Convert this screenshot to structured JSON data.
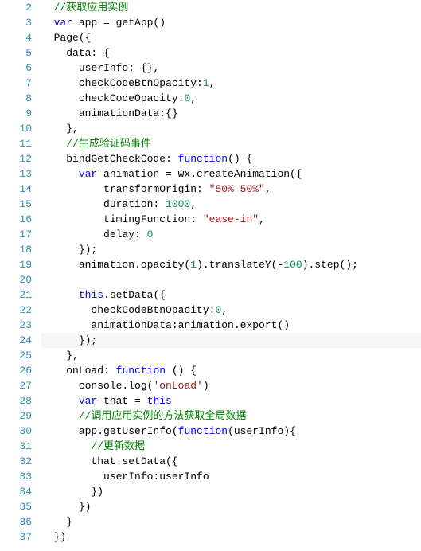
{
  "lines": [
    {
      "num": 2,
      "indent": 1,
      "tokens": [
        {
          "c": "c",
          "t": "//获取应用实例"
        }
      ]
    },
    {
      "num": 3,
      "indent": 1,
      "tokens": [
        {
          "c": "k",
          "t": "var"
        },
        {
          "c": "p",
          "t": " app = getApp()"
        }
      ]
    },
    {
      "num": 4,
      "indent": 1,
      "tokens": [
        {
          "c": "p",
          "t": "Page({"
        }
      ]
    },
    {
      "num": 5,
      "indent": 2,
      "tokens": [
        {
          "c": "p",
          "t": "data: {"
        }
      ]
    },
    {
      "num": 6,
      "indent": 3,
      "tokens": [
        {
          "c": "p",
          "t": "userInfo: {},"
        }
      ]
    },
    {
      "num": 7,
      "indent": 3,
      "tokens": [
        {
          "c": "p",
          "t": "checkCodeBtnOpacity:"
        },
        {
          "c": "n",
          "t": "1"
        },
        {
          "c": "p",
          "t": ","
        }
      ]
    },
    {
      "num": 8,
      "indent": 3,
      "tokens": [
        {
          "c": "p",
          "t": "checkCodeOpacity:"
        },
        {
          "c": "n",
          "t": "0"
        },
        {
          "c": "p",
          "t": ","
        }
      ]
    },
    {
      "num": 9,
      "indent": 3,
      "tokens": [
        {
          "c": "p",
          "t": "animationData:{}"
        }
      ]
    },
    {
      "num": 10,
      "indent": 2,
      "tokens": [
        {
          "c": "p",
          "t": "},"
        }
      ]
    },
    {
      "num": 11,
      "indent": 2,
      "tokens": [
        {
          "c": "c",
          "t": "//生成验证码事件"
        }
      ]
    },
    {
      "num": 12,
      "indent": 2,
      "tokens": [
        {
          "c": "p",
          "t": "bindGetCheckCode: "
        },
        {
          "c": "k",
          "t": "function"
        },
        {
          "c": "p",
          "t": "() {"
        }
      ]
    },
    {
      "num": 13,
      "indent": 3,
      "tokens": [
        {
          "c": "k",
          "t": "var"
        },
        {
          "c": "p",
          "t": " animation = wx.createAnimation({"
        }
      ]
    },
    {
      "num": 14,
      "indent": 5,
      "tokens": [
        {
          "c": "p",
          "t": "transformOrigin: "
        },
        {
          "c": "s",
          "t": "\"50% 50%\""
        },
        {
          "c": "p",
          "t": ","
        }
      ]
    },
    {
      "num": 15,
      "indent": 5,
      "tokens": [
        {
          "c": "p",
          "t": "duration: "
        },
        {
          "c": "n",
          "t": "1000"
        },
        {
          "c": "p",
          "t": ","
        }
      ]
    },
    {
      "num": 16,
      "indent": 5,
      "tokens": [
        {
          "c": "p",
          "t": "timingFunction: "
        },
        {
          "c": "s",
          "t": "\"ease-in\""
        },
        {
          "c": "p",
          "t": ","
        }
      ]
    },
    {
      "num": 17,
      "indent": 5,
      "tokens": [
        {
          "c": "p",
          "t": "delay: "
        },
        {
          "c": "n",
          "t": "0"
        }
      ]
    },
    {
      "num": 18,
      "indent": 3,
      "tokens": [
        {
          "c": "p",
          "t": "});"
        }
      ]
    },
    {
      "num": 19,
      "indent": 3,
      "tokens": [
        {
          "c": "p",
          "t": "animation.opacity("
        },
        {
          "c": "n",
          "t": "1"
        },
        {
          "c": "p",
          "t": ").translateY(-"
        },
        {
          "c": "n",
          "t": "100"
        },
        {
          "c": "p",
          "t": ").step();"
        }
      ]
    },
    {
      "num": 20,
      "indent": 0,
      "tokens": [
        {
          "c": "p",
          "t": ""
        }
      ]
    },
    {
      "num": 21,
      "indent": 3,
      "tokens": [
        {
          "c": "k",
          "t": "this"
        },
        {
          "c": "p",
          "t": ".setData({"
        }
      ]
    },
    {
      "num": 22,
      "indent": 4,
      "tokens": [
        {
          "c": "p",
          "t": "checkCodeBtnOpacity:"
        },
        {
          "c": "n",
          "t": "0"
        },
        {
          "c": "p",
          "t": ","
        }
      ]
    },
    {
      "num": 23,
      "indent": 4,
      "tokens": [
        {
          "c": "p",
          "t": "animationData:animation.export()"
        }
      ]
    },
    {
      "num": 24,
      "indent": 3,
      "hl": true,
      "tokens": [
        {
          "c": "p",
          "t": "});"
        }
      ]
    },
    {
      "num": 25,
      "indent": 2,
      "tokens": [
        {
          "c": "p",
          "t": "},"
        }
      ]
    },
    {
      "num": 26,
      "indent": 2,
      "tokens": [
        {
          "c": "p",
          "t": "onLoad: "
        },
        {
          "c": "k",
          "t": "function"
        },
        {
          "c": "p",
          "t": " () {"
        }
      ]
    },
    {
      "num": 27,
      "indent": 3,
      "tokens": [
        {
          "c": "p",
          "t": "console.log("
        },
        {
          "c": "s",
          "t": "'onLoad'"
        },
        {
          "c": "p",
          "t": ")"
        }
      ]
    },
    {
      "num": 28,
      "indent": 3,
      "tokens": [
        {
          "c": "k",
          "t": "var"
        },
        {
          "c": "p",
          "t": " that = "
        },
        {
          "c": "k",
          "t": "this"
        }
      ]
    },
    {
      "num": 29,
      "indent": 3,
      "tokens": [
        {
          "c": "c",
          "t": "//调用应用实例的方法获取全局数据"
        }
      ]
    },
    {
      "num": 30,
      "indent": 3,
      "tokens": [
        {
          "c": "p",
          "t": "app.getUserInfo("
        },
        {
          "c": "k",
          "t": "function"
        },
        {
          "c": "p",
          "t": "(userInfo){"
        }
      ]
    },
    {
      "num": 31,
      "indent": 4,
      "tokens": [
        {
          "c": "c",
          "t": "//更新数据"
        }
      ]
    },
    {
      "num": 32,
      "indent": 4,
      "tokens": [
        {
          "c": "p",
          "t": "that.setData({"
        }
      ]
    },
    {
      "num": 33,
      "indent": 5,
      "tokens": [
        {
          "c": "p",
          "t": "userInfo:userInfo"
        }
      ]
    },
    {
      "num": 34,
      "indent": 4,
      "tokens": [
        {
          "c": "p",
          "t": "})"
        }
      ]
    },
    {
      "num": 35,
      "indent": 3,
      "tokens": [
        {
          "c": "p",
          "t": "})"
        }
      ]
    },
    {
      "num": 36,
      "indent": 2,
      "tokens": [
        {
          "c": "p",
          "t": "}"
        }
      ]
    },
    {
      "num": 37,
      "indent": 1,
      "tokens": [
        {
          "c": "p",
          "t": "})"
        }
      ]
    }
  ],
  "indentUnit": "  "
}
